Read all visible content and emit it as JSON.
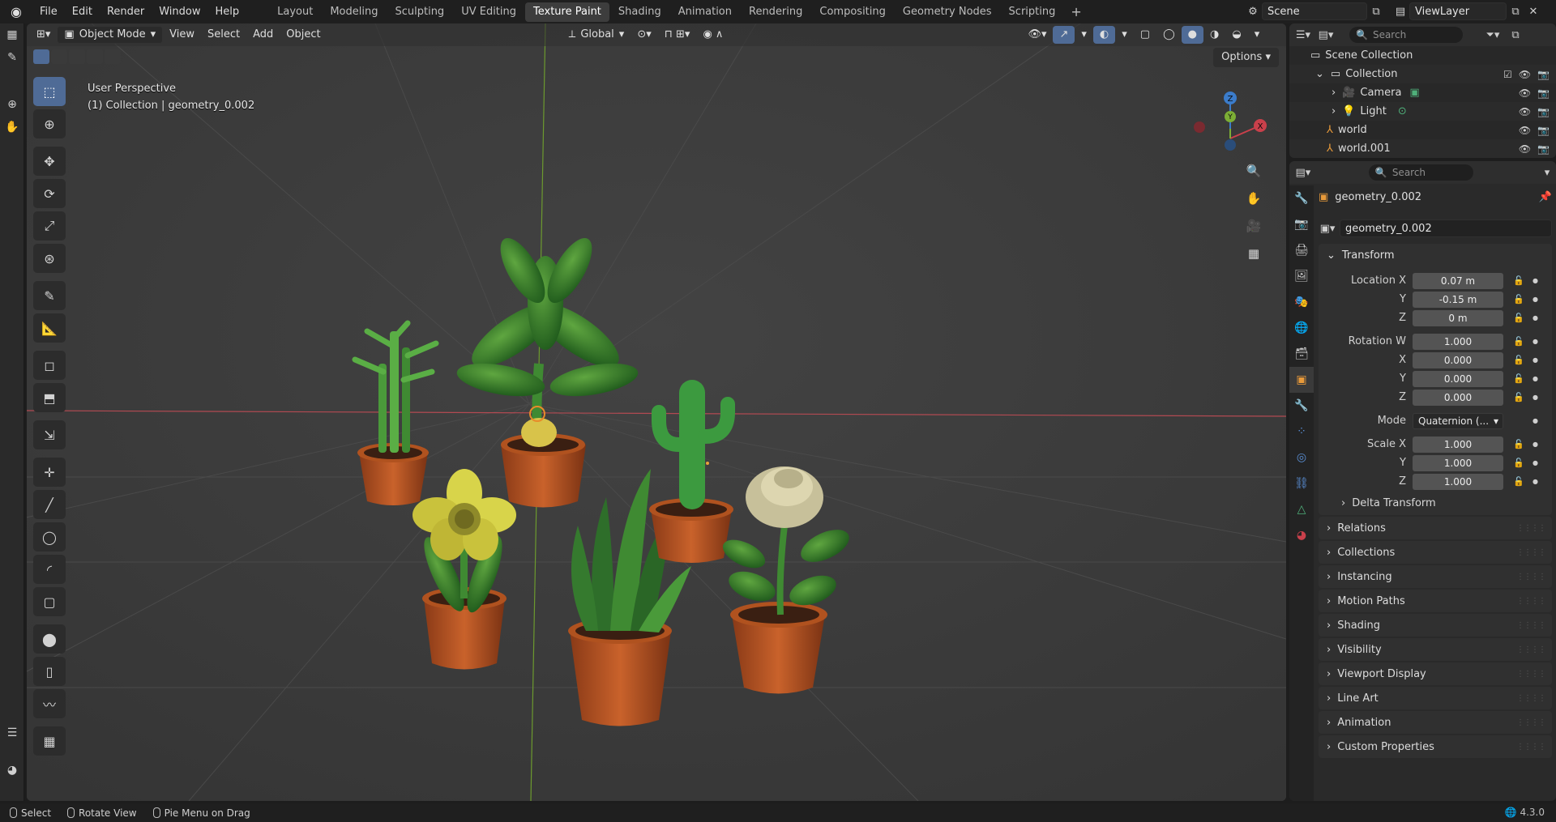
{
  "topbar": {
    "menus": [
      "File",
      "Edit",
      "Render",
      "Window",
      "Help"
    ],
    "workspaces": [
      "Layout",
      "Modeling",
      "Sculpting",
      "UV Editing",
      "Texture Paint",
      "Shading",
      "Animation",
      "Rendering",
      "Compositing",
      "Geometry Nodes",
      "Scripting"
    ],
    "active_workspace": "Texture Paint",
    "add_workspace": "+",
    "scene": "Scene",
    "view_layer": "ViewLayer"
  },
  "viewport": {
    "mode": "Object Mode",
    "menus": [
      "View",
      "Select",
      "Add",
      "Object"
    ],
    "transform_orientation": "Global",
    "options": "Options",
    "info_line1": "User Perspective",
    "info_line2": "(1) Collection | geometry_0.002",
    "gizmo_axes": [
      "Z",
      "X",
      "Y"
    ]
  },
  "outliner": {
    "search_placeholder": "Search",
    "rows": [
      {
        "label": "Scene Collection",
        "indent": 0
      },
      {
        "label": "Collection",
        "indent": 1
      },
      {
        "label": "Camera",
        "indent": 2
      },
      {
        "label": "Light",
        "indent": 2
      },
      {
        "label": "world",
        "indent": 1
      },
      {
        "label": "world.001",
        "indent": 1
      }
    ]
  },
  "properties": {
    "search_placeholder": "Search",
    "object_name": "geometry_0.002",
    "datablock_name": "geometry_0.002",
    "transform": {
      "title": "Transform",
      "location_label": "Location X",
      "location": [
        "0.07 m",
        "-0.15 m",
        "0 m"
      ],
      "rotation_label": "Rotation W",
      "rotation": [
        "1.000",
        "0.000",
        "0.000",
        "0.000"
      ],
      "mode_label": "Mode",
      "mode_value": "Quaternion (...",
      "scale_label": "Scale X",
      "scale": [
        "1.000",
        "1.000",
        "1.000"
      ],
      "axis_y": "Y",
      "axis_z": "Z",
      "axis_x": "X",
      "delta": "Delta Transform"
    },
    "panels": [
      "Relations",
      "Collections",
      "Instancing",
      "Motion Paths",
      "Shading",
      "Visibility",
      "Viewport Display",
      "Line Art",
      "Animation",
      "Custom Properties"
    ]
  },
  "statusbar": {
    "select": "Select",
    "rotate": "Rotate View",
    "pie": "Pie Menu on Drag",
    "version": "4.3.0"
  },
  "colors": {
    "accent": "#4f6b96",
    "x_axis": "#c9404b",
    "y_axis": "#7cae35",
    "z_axis": "#3b7ccb"
  }
}
